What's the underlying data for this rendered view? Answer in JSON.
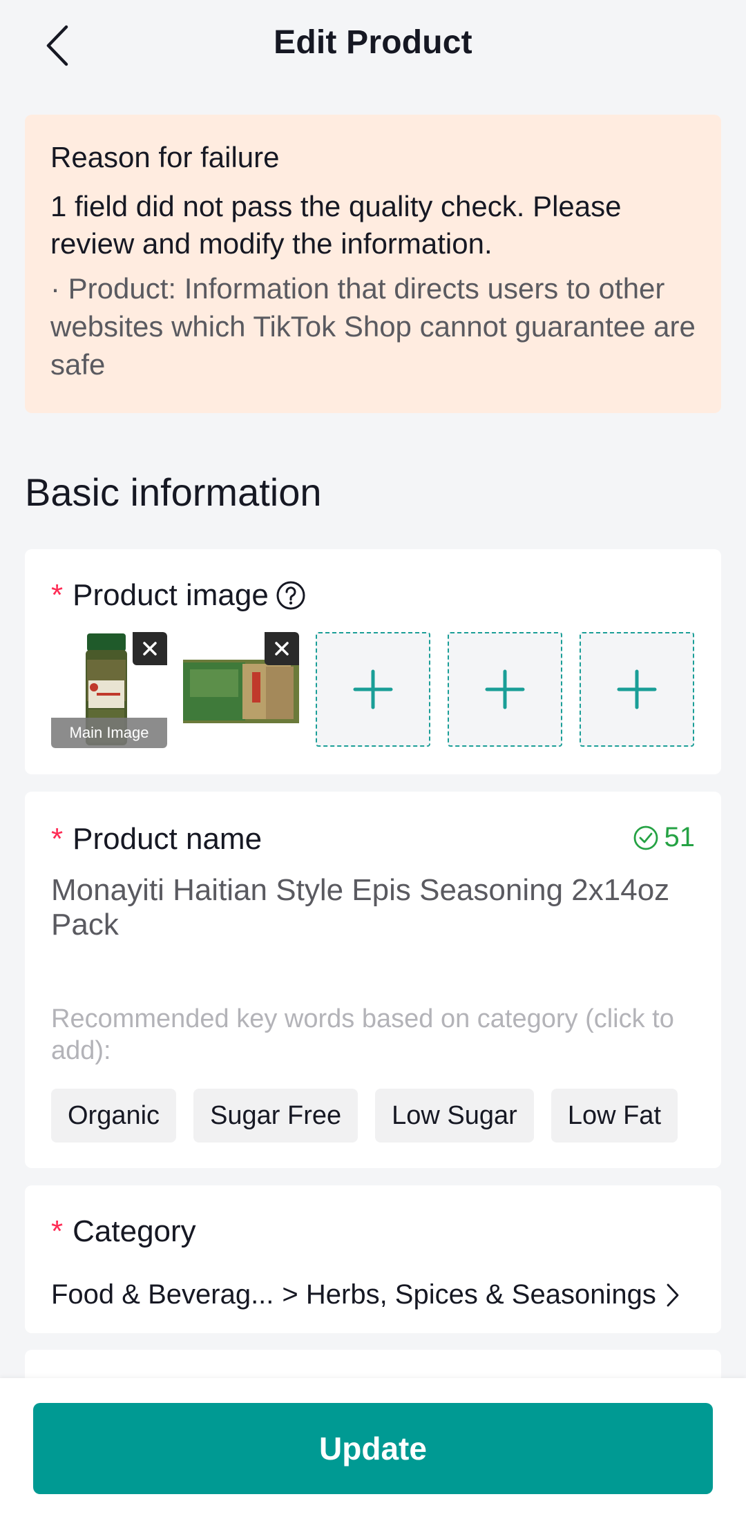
{
  "header": {
    "title": "Edit Product",
    "back_icon": "chevron-left-icon"
  },
  "failure": {
    "title": "Reason for failure",
    "message": "1 field did not pass the quality check. Please review and modify the information.",
    "detail": "· Product: Information that directs users to other websites which TikTok Shop cannot guarantee are safe"
  },
  "basic_info": {
    "section_title": "Basic information",
    "required_mark": "*",
    "product_image": {
      "label": "Product image",
      "main_badge": "Main Image",
      "images": [
        {
          "alt": "product-bottle",
          "is_main": true
        },
        {
          "alt": "product-jars",
          "is_main": false
        }
      ],
      "empty_slots": 3
    },
    "product_name": {
      "label": "Product name",
      "char_count": "51",
      "value": "Monayiti Haitian Style Epis Seasoning 2x14oz   Pack",
      "keyword_hint": "Recommended key words based on category (click to add):",
      "keywords": [
        "Organic",
        "Sugar Free",
        "Low Sugar",
        "Low Fat"
      ]
    },
    "category": {
      "label": "Category",
      "path_root": "Food & Beverag...",
      "path_leaf": "> Herbs, Spices & Seasonings"
    }
  },
  "actions": {
    "update_label": "Update"
  },
  "colors": {
    "accent": "#009a93",
    "required": "#fe2c55",
    "success": "#25a244",
    "failure_bg": "#ffece0"
  }
}
